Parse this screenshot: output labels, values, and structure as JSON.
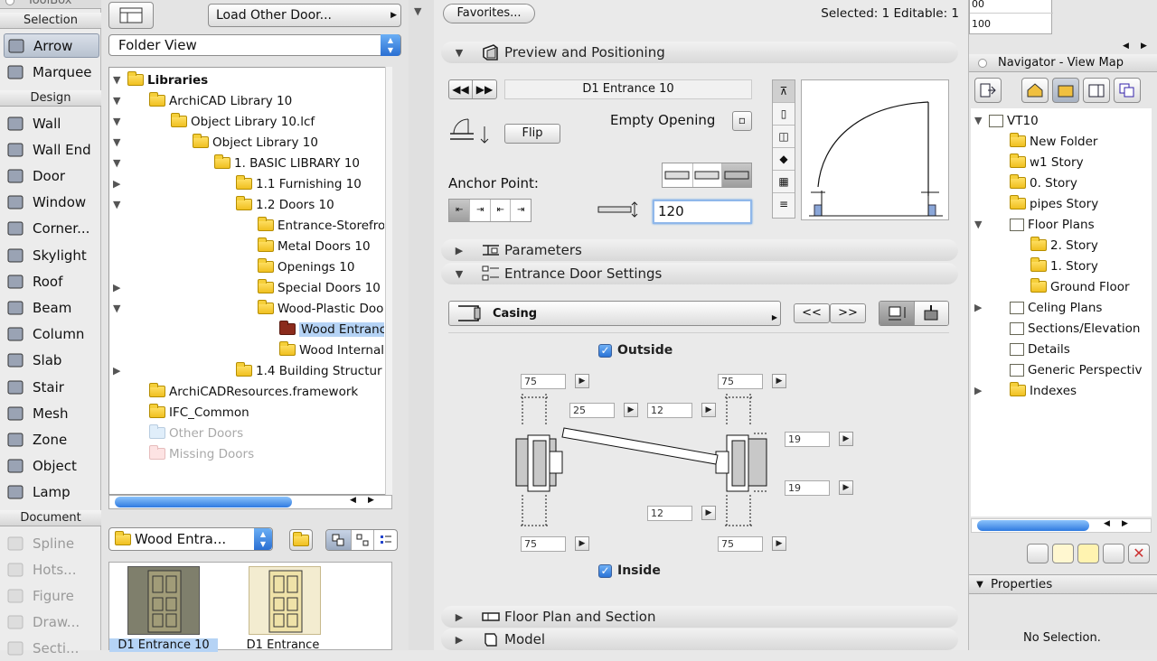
{
  "toolbox": {
    "title": "ToolBox",
    "selection_header": "Selection",
    "selection_tools": [
      {
        "label": "Arrow",
        "icon": "arrow-cursor-icon",
        "selected": true
      },
      {
        "label": "Marquee",
        "icon": "marquee-icon",
        "selected": false
      }
    ],
    "design_header": "Design",
    "design_tools": [
      {
        "label": "Wall",
        "icon": "wall-icon"
      },
      {
        "label": "Wall End",
        "icon": "wall-end-icon"
      },
      {
        "label": "Door",
        "icon": "door-icon"
      },
      {
        "label": "Window",
        "icon": "window-icon"
      },
      {
        "label": "Corner...",
        "icon": "corner-window-icon"
      },
      {
        "label": "Skylight",
        "icon": "skylight-icon"
      },
      {
        "label": "Roof",
        "icon": "roof-icon"
      },
      {
        "label": "Beam",
        "icon": "beam-icon"
      },
      {
        "label": "Column",
        "icon": "column-icon"
      },
      {
        "label": "Slab",
        "icon": "slab-icon"
      },
      {
        "label": "Stair",
        "icon": "stair-icon"
      },
      {
        "label": "Mesh",
        "icon": "mesh-icon"
      },
      {
        "label": "Zone",
        "icon": "zone-icon"
      },
      {
        "label": "Object",
        "icon": "object-icon"
      },
      {
        "label": "Lamp",
        "icon": "lamp-icon"
      }
    ],
    "document_header": "Document",
    "document_tools": [
      {
        "label": "Spline",
        "icon": "spline-icon"
      },
      {
        "label": "Hots...",
        "icon": "hotspot-icon"
      },
      {
        "label": "Figure",
        "icon": "figure-icon"
      },
      {
        "label": "Draw...",
        "icon": "drawing-icon"
      },
      {
        "label": "Secti...",
        "icon": "section-icon"
      }
    ]
  },
  "library": {
    "load_other_label": "Load Other Door...",
    "view_select": "Folder View",
    "tree": [
      {
        "label": "Libraries",
        "indent": 0,
        "arrow": "down",
        "bold": true,
        "folder": "normal"
      },
      {
        "label": "ArchiCAD Library 10",
        "indent": 1,
        "arrow": "down",
        "folder": "normal"
      },
      {
        "label": "Object Library 10.lcf",
        "indent": 2,
        "arrow": "down",
        "folder": "normal"
      },
      {
        "label": "Object Library 10",
        "indent": 3,
        "arrow": "down",
        "folder": "normal"
      },
      {
        "label": "1. BASIC LIBRARY 10",
        "indent": 4,
        "arrow": "down",
        "folder": "normal"
      },
      {
        "label": "1.1 Furnishing 10",
        "indent": 5,
        "arrow": "right",
        "folder": "normal"
      },
      {
        "label": "1.2 Doors 10",
        "indent": 5,
        "arrow": "down",
        "folder": "normal"
      },
      {
        "label": "Entrance-Storefro",
        "indent": 6,
        "arrow": "",
        "folder": "normal"
      },
      {
        "label": "Metal Doors 10",
        "indent": 6,
        "arrow": "",
        "folder": "normal"
      },
      {
        "label": "Openings 10",
        "indent": 6,
        "arrow": "",
        "folder": "normal"
      },
      {
        "label": "Special Doors 10",
        "indent": 6,
        "arrow": "right",
        "folder": "normal"
      },
      {
        "label": "Wood-Plastic Doo",
        "indent": 6,
        "arrow": "down",
        "folder": "normal"
      },
      {
        "label": "Wood Entranc",
        "indent": 7,
        "arrow": "",
        "folder": "red",
        "selected": true
      },
      {
        "label": "Wood Internal",
        "indent": 7,
        "arrow": "",
        "folder": "normal"
      },
      {
        "label": "1.4 Building Structur",
        "indent": 5,
        "arrow": "right",
        "folder": "normal"
      },
      {
        "label": "ArchiCADResources.framework",
        "indent": 1,
        "arrow": "",
        "folder": "normal"
      },
      {
        "label": "IFC_Common",
        "indent": 1,
        "arrow": "",
        "folder": "normal"
      },
      {
        "label": "Other Doors",
        "indent": 1,
        "arrow": "",
        "folder": "dim",
        "dim": true
      },
      {
        "label": "Missing Doors",
        "indent": 1,
        "arrow": "",
        "folder": "pink",
        "dim": true
      }
    ],
    "folder_popup": "Wood Entra...",
    "thumbnails": [
      {
        "label": "D1 Entrance 10",
        "selected": true
      },
      {
        "label": "D1 Entrance",
        "selected": false
      }
    ]
  },
  "settings": {
    "favorites_label": "Favorites...",
    "selected_info": "Selected: 1 Editable: 1",
    "preview_section": "Preview and Positioning",
    "object_name": "D1 Entrance 10",
    "flip_label": "Flip",
    "empty_opening_label": "Empty Opening",
    "anchor_label": "Anchor Point:",
    "anchor_value": "120",
    "parameters_section": "Parameters",
    "entrance_section": "Entrance Door Settings",
    "casing_label": "Casing",
    "prev_label": "<<",
    "next_label": ">>",
    "outside_label": "Outside",
    "inside_label": "Inside",
    "dims": {
      "left_top_width": "75",
      "right_top_width": "75",
      "left_inner": "25",
      "mid_top": "12",
      "right_depth_top": "19",
      "right_depth_bottom": "19",
      "mid_bottom": "12",
      "left_bottom_width": "75",
      "right_bottom_width": "75"
    },
    "floorplan_section": "Floor Plan and Section",
    "model_section": "Model"
  },
  "navigator": {
    "top_fields": [
      "00",
      "100"
    ],
    "title": "Navigator - View Map",
    "tree": [
      {
        "label": "VT10",
        "indent": 0,
        "arrow": "down",
        "icon": "project-icon"
      },
      {
        "label": "New Folder",
        "indent": 1,
        "arrow": "",
        "icon": "folder-icon"
      },
      {
        "label": "w1 Story",
        "indent": 1,
        "arrow": "",
        "icon": "folder-icon"
      },
      {
        "label": "0. Story",
        "indent": 1,
        "arrow": "",
        "icon": "folder-icon"
      },
      {
        "label": "pipes Story",
        "indent": 1,
        "arrow": "",
        "icon": "folder-icon"
      },
      {
        "label": "Floor Plans",
        "indent": 1,
        "arrow": "down",
        "icon": "floor-plans-icon"
      },
      {
        "label": "2. Story",
        "indent": 2,
        "arrow": "",
        "icon": "folder-icon"
      },
      {
        "label": "1. Story",
        "indent": 2,
        "arrow": "",
        "icon": "folder-icon"
      },
      {
        "label": "Ground Floor",
        "indent": 2,
        "arrow": "",
        "icon": "folder-icon"
      },
      {
        "label": "Celing Plans",
        "indent": 1,
        "arrow": "right",
        "icon": "ceiling-plans-icon"
      },
      {
        "label": "Sections/Elevation",
        "indent": 1,
        "arrow": "",
        "icon": "sections-icon"
      },
      {
        "label": "Details",
        "indent": 1,
        "arrow": "",
        "icon": "details-icon"
      },
      {
        "label": "Generic Perspectiv",
        "indent": 1,
        "arrow": "",
        "icon": "perspective-icon"
      },
      {
        "label": "Indexes",
        "indent": 1,
        "arrow": "right",
        "icon": "folder-icon"
      }
    ],
    "properties_label": "Properties",
    "no_selection": "No Selection."
  }
}
